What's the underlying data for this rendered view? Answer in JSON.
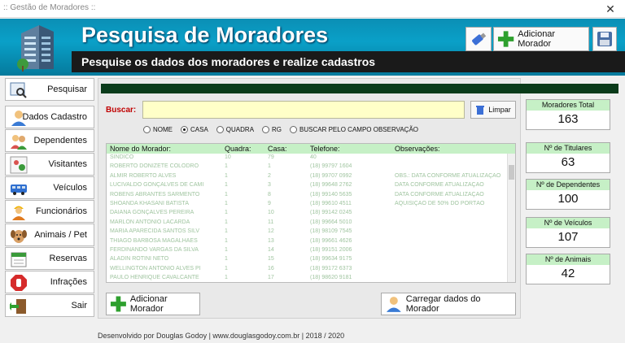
{
  "window": {
    "title": ":: Gestão de Moradores ::",
    "close": "✕"
  },
  "header": {
    "title": "Pesquisa de Moradores",
    "subtitle": "Pesquise os dados dos moradores e realize cadastros",
    "add_button": "Adicionar Morador"
  },
  "sidebar": {
    "items": [
      {
        "label": "Pesquisar",
        "icon": "search-window-icon"
      },
      {
        "label": "Dados Cadastro",
        "icon": "user-icon"
      },
      {
        "label": "Dependentes",
        "icon": "users-icon"
      },
      {
        "label": "Visitantes",
        "icon": "visitor-icon"
      },
      {
        "label": "Veículos",
        "icon": "bus-icon"
      },
      {
        "label": "Funcionários",
        "icon": "worker-icon"
      },
      {
        "label": "Animais / Pet",
        "icon": "dog-icon"
      },
      {
        "label": "Reservas",
        "icon": "calendar-icon"
      },
      {
        "label": "Infrações",
        "icon": "stop-icon"
      },
      {
        "label": "Sair",
        "icon": "exit-door-icon"
      }
    ]
  },
  "search": {
    "label": "Buscar:",
    "value": "",
    "clear_button": "Limpar"
  },
  "filters": [
    {
      "label": "NOME",
      "selected": false
    },
    {
      "label": "CASA",
      "selected": true
    },
    {
      "label": "QUADRA",
      "selected": false
    },
    {
      "label": "RG",
      "selected": false
    },
    {
      "label": "BUSCAR PELO CAMPO OBSERVAÇÃO",
      "selected": false
    }
  ],
  "table": {
    "columns": [
      "Nome do Morador:",
      "Quadra:",
      "Casa:",
      "Telefone:",
      "Observações:"
    ],
    "rows": [
      [
        "SÍNDICO",
        "10",
        "79",
        "40",
        ""
      ],
      [
        "ROBERTO DONIZETE COLODRO",
        "1",
        "1",
        "(18) 99797 1604",
        ""
      ],
      [
        "ALMIR ROBERTO ALVES",
        "1",
        "2",
        "(18) 99707 0992",
        "OBS.: DATA CONFORME ATUALIZAÇÃO"
      ],
      [
        "LUCIVALDO GONÇALVES DE CAMI",
        "1",
        "3",
        "(18) 99648 2762",
        "DATA CONFORME ATUALIZAÇÃO"
      ],
      [
        "ROBENS ABRANTES SARMENTO",
        "1",
        "8",
        "(18) 99140 5635",
        "DATA CONFORME ATUALIZAÇÃO"
      ],
      [
        "SHOANDA KHASANI BATISTA",
        "1",
        "9",
        "(18) 99610 4511",
        "AQUISIÇÃO DE 50% DO PORTÃO"
      ],
      [
        "DAIANA GONÇALVES PEREIRA",
        "1",
        "10",
        "(18) 99142 0245",
        ""
      ],
      [
        "MARLON ANTONIO LACARDA",
        "1",
        "11",
        "(18) 99664 5010",
        ""
      ],
      [
        "MARIA APARECIDA SANTOS SILV",
        "1",
        "12",
        "(18) 98109 7545",
        ""
      ],
      [
        "THIAGO BARBOSA MAGALHÃES",
        "1",
        "13",
        "(18) 99661 4626",
        ""
      ],
      [
        "FERDINANDO VARGAS DA SILVA",
        "1",
        "14",
        "(18) 99151 2006",
        ""
      ],
      [
        "ALADIN ROTINI NETO",
        "1",
        "15",
        "(18) 99634 9175",
        ""
      ],
      [
        "WELLINGTON ANTONIO ALVES PI",
        "1",
        "16",
        "(18) 99172 6373",
        ""
      ],
      [
        "PAULO HENRIQUE CAVALCANTE",
        "1",
        "17",
        "(18) 98620 9181",
        ""
      ]
    ]
  },
  "actions": {
    "add": "Adicionar Morador",
    "load": "Carregar dados do Morador"
  },
  "stats": [
    {
      "label": "Moradores Total",
      "value": "163"
    },
    {
      "label": "Nº de Titulares",
      "value": "63"
    },
    {
      "label": "Nº de Dependentes",
      "value": "100"
    },
    {
      "label": "Nº de Veículos",
      "value": "107"
    },
    {
      "label": "Nº de Animais",
      "value": "42"
    }
  ],
  "footer": "Desenvolvido por Douglas Godoy | www.douglasgodoy.com.br | 2018 / 2020",
  "colors": {
    "header": "#0aa0c8",
    "accent_green": "#c6f0c6",
    "dark_bar": "#0a3b1a",
    "search_bg": "#ffffc8",
    "buscar_label": "#c00000"
  }
}
